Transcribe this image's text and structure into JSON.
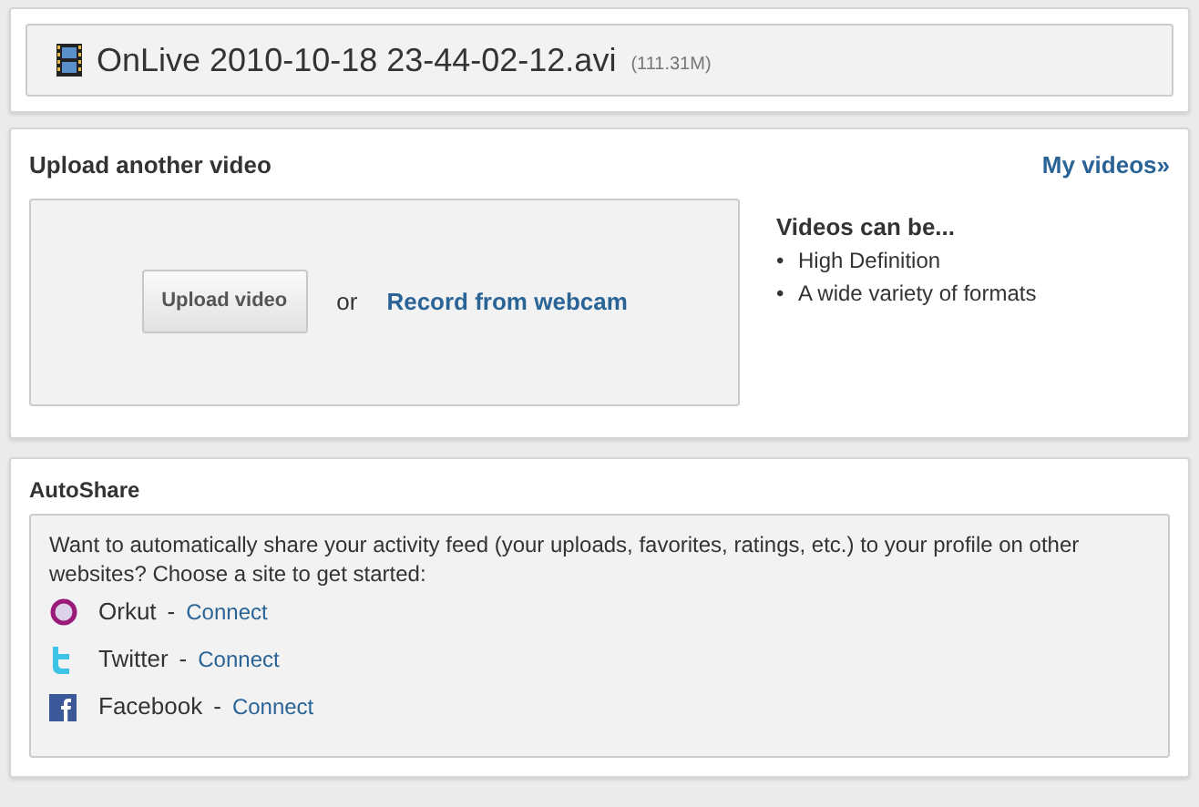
{
  "file": {
    "name": "OnLive 2010-10-18 23-44-02-12.avi",
    "size": "(111.31M)"
  },
  "upload": {
    "title": "Upload another video",
    "my_videos": "My videos»",
    "button": "Upload video",
    "or": "or",
    "webcam": "Record from webcam",
    "info_title": "Videos can be...",
    "info_items": [
      {
        "bullet": "•",
        "text": "High Definition"
      },
      {
        "bullet": "•",
        "text": "A wide variety of formats"
      }
    ]
  },
  "autoshare": {
    "title": "AutoShare",
    "intro": "Want to automatically share your activity feed (your uploads, favorites, ratings, etc.) to your profile on other websites? Choose a site to get started:",
    "sites": [
      {
        "name": "Orkut",
        "kind": "ring",
        "separator": "-",
        "link": "Connect"
      },
      {
        "name": "Twitter",
        "kind": "tee",
        "separator": "-",
        "link": "Connect"
      },
      {
        "name": "Facebook",
        "kind": "square",
        "separator": "-",
        "link": "Connect"
      }
    ]
  }
}
